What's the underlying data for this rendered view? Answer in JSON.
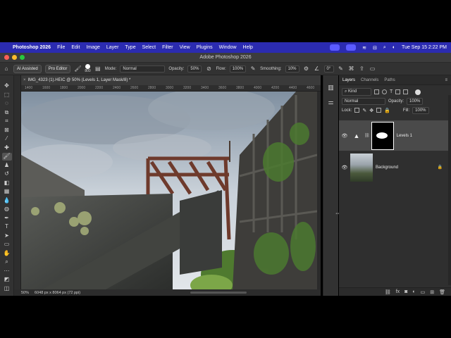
{
  "menubar": {
    "app_name": "Photoshop 2026",
    "items": [
      "File",
      "Edit",
      "Image",
      "Layer",
      "Type",
      "Select",
      "Filter",
      "View",
      "Plugins",
      "Window",
      "Help"
    ],
    "clock": "Tue Sep 15  2:22 PM"
  },
  "window": {
    "title": "Adobe Photoshop 2026"
  },
  "options_bar": {
    "ai_assisted": "AI Assisted",
    "pro_editor": "Pro Editor",
    "brush_size": "800",
    "mode_label": "Mode:",
    "mode_value": "Normal",
    "opacity_label": "Opacity:",
    "opacity_value": "50%",
    "flow_label": "Flow:",
    "flow_value": "100%",
    "smoothing_label": "Smoothing:",
    "smoothing_value": "10%",
    "angle_value": "0°"
  },
  "document": {
    "tab_title": "IMG_4323 (1).HEIC @ 50% (Levels 1, Layer Mask/8) *",
    "ruler_ticks": [
      "1400",
      "1600",
      "1800",
      "2000",
      "2200",
      "2400",
      "2600",
      "2800",
      "3000",
      "3200",
      "3400",
      "3600",
      "3800",
      "4000",
      "4200",
      "4400",
      "4600"
    ],
    "zoom": "50%",
    "doc_info": "6048 px x 8064 px (72 ppi)"
  },
  "layers_panel": {
    "tabs": [
      "Layers",
      "Channels",
      "Paths"
    ],
    "filter_kind": "Kind",
    "blend_mode": "Normal",
    "opacity_label": "Opacity:",
    "opacity_value": "100%",
    "lock_label": "Lock:",
    "fill_label": "Fill:",
    "fill_value": "100%",
    "layers": [
      {
        "name": "Levels 1",
        "selected": true
      },
      {
        "name": "Background",
        "locked": true
      }
    ]
  },
  "colors": {
    "menubar_bg": "#2b2bb0",
    "panel_bg": "#2f2f2f",
    "selected_layer": "#4a4a4a"
  }
}
